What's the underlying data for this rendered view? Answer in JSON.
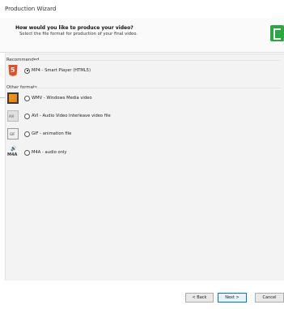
{
  "window": {
    "title": "Production Wizard"
  },
  "header": {
    "question": "How would you like to produce your video?",
    "subtitle": "Select the file format for production of your final video."
  },
  "sections": {
    "recommended_label": "Recommended",
    "other_label": "Other formats"
  },
  "options": [
    {
      "label": "MP4 - Smart Player (HTML5)",
      "selected": true,
      "icon": "html5-icon"
    },
    {
      "label": "WMV - Windows Media video",
      "selected": false,
      "icon": "wmv-icon"
    },
    {
      "label": "AVI - Audio Video Interleave video file",
      "selected": false,
      "icon": "avi-icon"
    },
    {
      "label": "GIF - animation file",
      "selected": false,
      "icon": "gif-icon"
    },
    {
      "label": "M4A - audio only",
      "selected": false,
      "icon": "m4a-icon",
      "icon_text": "M4A"
    }
  ],
  "footer": {
    "back_label": "< Back",
    "next_label": "Next >",
    "cancel_label": "Cancel"
  }
}
